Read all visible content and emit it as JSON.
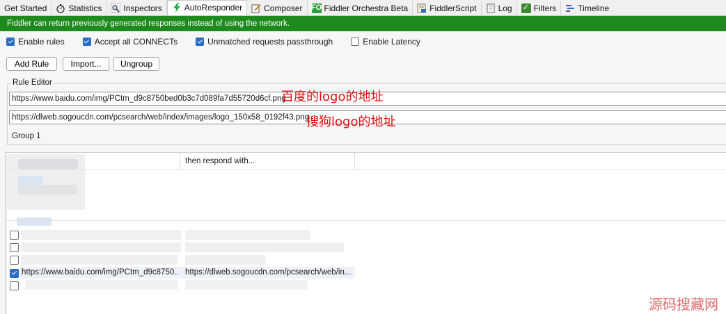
{
  "tabs": [
    {
      "label": "Get Started",
      "icon": "none",
      "active": false
    },
    {
      "label": "Statistics",
      "icon": "stopwatch-icon",
      "active": false
    },
    {
      "label": "Inspectors",
      "icon": "magnifier-icon",
      "active": false
    },
    {
      "label": "AutoResponder",
      "icon": "lightning-icon",
      "active": true
    },
    {
      "label": "Composer",
      "icon": "pencil-icon",
      "active": false
    },
    {
      "label": "Fiddler Orchestra Beta",
      "icon": "fo-icon",
      "icon_text": "FO",
      "active": false
    },
    {
      "label": "FiddlerScript",
      "icon": "script-icon",
      "active": false
    },
    {
      "label": "Log",
      "icon": "document-icon",
      "active": false
    },
    {
      "label": "Filters",
      "icon": "check-icon",
      "active": false
    },
    {
      "label": "Timeline",
      "icon": "timeline-icon",
      "active": false
    }
  ],
  "banner": {
    "text": "Fiddler can return previously generated responses instead of using the network.",
    "color": "#1e8a1e"
  },
  "options": {
    "enable_rules": {
      "label": "Enable rules",
      "checked": true
    },
    "accept_connects": {
      "label": "Accept all CONNECTs",
      "checked": true
    },
    "unmatched_passthrough": {
      "label": "Unmatched requests passthrough",
      "checked": true
    },
    "enable_latency": {
      "label": "Enable Latency",
      "checked": false
    }
  },
  "buttons": {
    "add_rule": "Add Rule",
    "import": "Import...",
    "ungroup": "Ungroup"
  },
  "rule_editor": {
    "legend": "Rule Editor",
    "match_value": "https://www.baidu.com/img/PCtm_d9c8750bed0b3c7d089fa7d55720d6cf.png",
    "action_value": "https://dlweb.sogoucdn.com/pcsearch/web/index/images/logo_150x58_0192f43.png",
    "group_value": "Group 1"
  },
  "annotations": {
    "match_note": "百度的logo的地址",
    "action_note": "搜狗logo的地址"
  },
  "rules_table": {
    "column_action": "then respond with...",
    "rows": [
      {
        "checked": false,
        "match": "",
        "action": ""
      },
      {
        "checked": false,
        "match": "",
        "action": ""
      },
      {
        "checked": false,
        "match": "",
        "action": ""
      },
      {
        "checked": true,
        "match": "https://www.baidu.com/img/PCtm_d9c8750...",
        "action": "https://dlweb.sogoucdn.com/pcsearch/web/in..."
      },
      {
        "checked": false,
        "match": "",
        "action": ""
      }
    ]
  },
  "watermark": "源码搜藏网",
  "colors": {
    "accent": "#2b6cc4",
    "banner": "#1e8a1e",
    "note": "#e01010"
  }
}
